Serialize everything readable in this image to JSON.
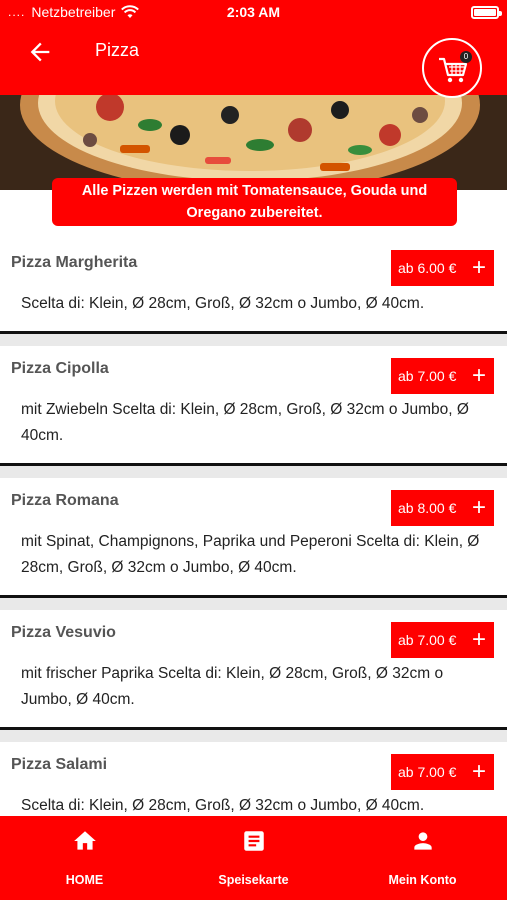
{
  "status_bar": {
    "carrier": "Netzbetreiber",
    "time": "2:03 AM"
  },
  "header": {
    "title": "Pizza",
    "cart_count": "0"
  },
  "banner": {
    "text": "Alle Pizzen werden mit Tomatensauce, Gouda und Oregano zubereitet."
  },
  "menu": {
    "items": [
      {
        "name": "Pizza Margherita",
        "price": "ab 6.00 €",
        "description": "Scelta di: Klein, Ø 28cm, Groß, Ø 32cm o Jumbo, Ø 40cm."
      },
      {
        "name": "Pizza Cipolla",
        "price": "ab 7.00 €",
        "description": "mit Zwiebeln Scelta di: Klein, Ø 28cm, Groß, Ø 32cm o Jumbo, Ø 40cm."
      },
      {
        "name": "Pizza Romana",
        "price": "ab 8.00 €",
        "description": "mit Spinat, Champignons, Paprika und Peperoni Scelta di: Klein, Ø 28cm, Groß, Ø 32cm o Jumbo, Ø 40cm."
      },
      {
        "name": "Pizza Vesuvio",
        "price": "ab 7.00 €",
        "description": "mit frischer Paprika Scelta di: Klein, Ø 28cm, Groß, Ø 32cm o Jumbo, Ø 40cm."
      },
      {
        "name": "Pizza Salami",
        "price": "ab 7.00 €",
        "description": "Scelta di: Klein, Ø 28cm, Groß, Ø 32cm o Jumbo, Ø 40cm."
      }
    ],
    "add_symbol": "+"
  },
  "bottom_nav": {
    "items": [
      {
        "label": "HOME",
        "icon": "home-icon"
      },
      {
        "label": "Speisekarte",
        "icon": "menu-book-icon"
      },
      {
        "label": "Mein Konto",
        "icon": "person-icon"
      }
    ]
  },
  "colors": {
    "primary": "#ff0000",
    "divider": "#111111",
    "text": "#222222",
    "item_name": "#555555"
  }
}
